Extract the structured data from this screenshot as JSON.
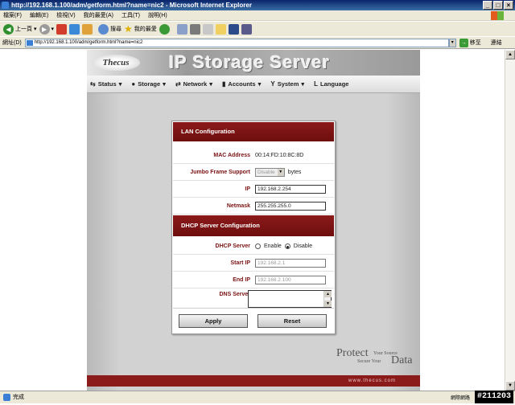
{
  "window": {
    "title": "http://192.168.1.100/adm/getform.html?name=nic2 - Microsoft Internet Explorer",
    "controls": [
      "_",
      "□",
      "×"
    ]
  },
  "menubar": [
    "檔案(F)",
    "編輯(E)",
    "檢視(V)",
    "我的最愛(A)",
    "工具(T)",
    "說明(H)"
  ],
  "toolbar": {
    "back": "上一頁",
    "search": "搜尋",
    "favorites": "我的最愛"
  },
  "address": {
    "label": "網址(D)",
    "url": "http://192.168.1.100/adm/getform.html?name=nic2",
    "go": "移至",
    "links": "連結"
  },
  "site": {
    "logo": "Thecus",
    "headline": "IP Storage Server",
    "nav": [
      {
        "icon": "⇆",
        "label": "Status"
      },
      {
        "icon": "●",
        "label": "Storage"
      },
      {
        "icon": "⇄",
        "label": "Network"
      },
      {
        "icon": "▮",
        "label": "Accounts"
      },
      {
        "icon": "Y",
        "label": "System"
      },
      {
        "icon": "L",
        "label": "Language"
      }
    ],
    "footer_url": "www.thecus.com",
    "slogan": {
      "w1": "Protect",
      "w2": "Your Source",
      "w3": "Secure Your",
      "w4": "Data"
    }
  },
  "lan": {
    "title": "LAN Configuration",
    "mac_label": "MAC Address",
    "mac_value": "00:14:FD:10:8C:8D",
    "jumbo_label": "Jumbo Frame Support",
    "jumbo_value": "Disable",
    "jumbo_unit": "bytes",
    "ip_label": "IP",
    "ip_value": "192.168.2.254",
    "netmask_label": "Netmask",
    "netmask_value": "255.255.255.0"
  },
  "dhcp": {
    "title": "DHCP Server Configuration",
    "server_label": "DHCP Server",
    "enable_label": "Enable",
    "disable_label": "Disable",
    "selected": "Disable",
    "start_label": "Start IP",
    "start_value": "192.168.2.1",
    "end_label": "End IP",
    "end_value": "192.168.2.100",
    "dns_label": "DNS Server",
    "dns_value": ""
  },
  "buttons": {
    "apply": "Apply",
    "reset": "Reset"
  },
  "status": {
    "text": "完成",
    "zone": "網際網路"
  },
  "watermark": "#211203",
  "colors": {
    "accent": "#8b1a1a",
    "label": "#7a1212"
  }
}
